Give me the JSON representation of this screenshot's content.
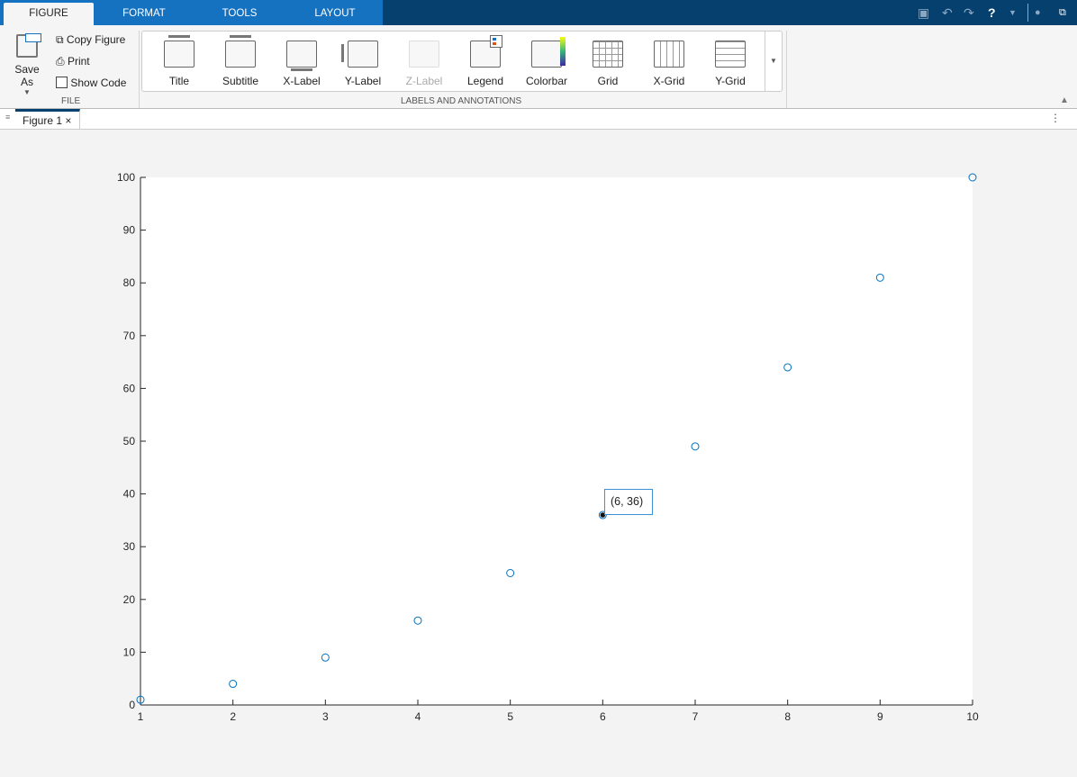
{
  "toolstrip": {
    "tabs": [
      "FIGURE",
      "FORMAT",
      "TOOLS",
      "LAYOUT"
    ],
    "active_tab": "FIGURE"
  },
  "file": {
    "save_as": "Save As",
    "copy_figure": "Copy Figure",
    "print": "Print",
    "show_code": "Show Code",
    "section": "FILE"
  },
  "annotations": {
    "items": [
      "Title",
      "Subtitle",
      "X-Label",
      "Y-Label",
      "Z-Label",
      "Legend",
      "Colorbar",
      "Grid",
      "X-Grid",
      "Y-Grid"
    ],
    "section": "LABELS AND ANNOTATIONS"
  },
  "document": {
    "tab": "Figure 1"
  },
  "datatip": {
    "label": "(6, 36)"
  },
  "chart_data": {
    "type": "scatter",
    "x": [
      1,
      2,
      3,
      4,
      5,
      6,
      7,
      8,
      9,
      10
    ],
    "y": [
      1,
      4,
      9,
      16,
      25,
      36,
      49,
      64,
      81,
      100
    ],
    "xlim": [
      1,
      10
    ],
    "ylim": [
      0,
      100
    ],
    "xticks": [
      1,
      2,
      3,
      4,
      5,
      6,
      7,
      8,
      9,
      10
    ],
    "yticks": [
      0,
      10,
      20,
      30,
      40,
      50,
      60,
      70,
      80,
      90,
      100
    ],
    "marker_color": "#0072bd",
    "grid": false,
    "highlighted_point": [
      6,
      36
    ]
  }
}
